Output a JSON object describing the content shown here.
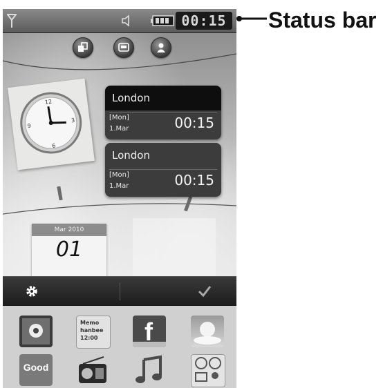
{
  "annotation": {
    "label": "Status bar"
  },
  "status_bar": {
    "time": "00:15",
    "icons": [
      "signal-icon",
      "speaker-icon",
      "battery-icon"
    ]
  },
  "shortcuts": [
    "swap-icon",
    "message-icon",
    "contact-icon"
  ],
  "world_clocks": [
    {
      "city": "London",
      "day": "[Mon]",
      "date": "1.Mar",
      "time": "00:15"
    },
    {
      "city": "London",
      "day": "[Mon]",
      "date": "1.Mar",
      "time": "00:15"
    }
  ],
  "calendar": {
    "header": "Mar 2010",
    "day": "01"
  },
  "toolbar": {
    "left_icon": "gear-icon",
    "right_icon": "checkmark-icon"
  },
  "apps": {
    "memo_line1": "Memo",
    "memo_line2": "hanbee",
    "memo_line3": "12:00",
    "good_label": "Good",
    "facebook_letter": "f",
    "icons": [
      "photo-icon",
      "memo-icon",
      "facebook-icon",
      "weather-icon",
      "good-icon",
      "radio-icon",
      "music-icon",
      "messaging-icon"
    ]
  },
  "colors": {
    "status_bar": "#6e6e6e",
    "card_dark": "#3c3c3c",
    "toolbar": "#2a2a2a",
    "tray": "#d0d0d0"
  }
}
